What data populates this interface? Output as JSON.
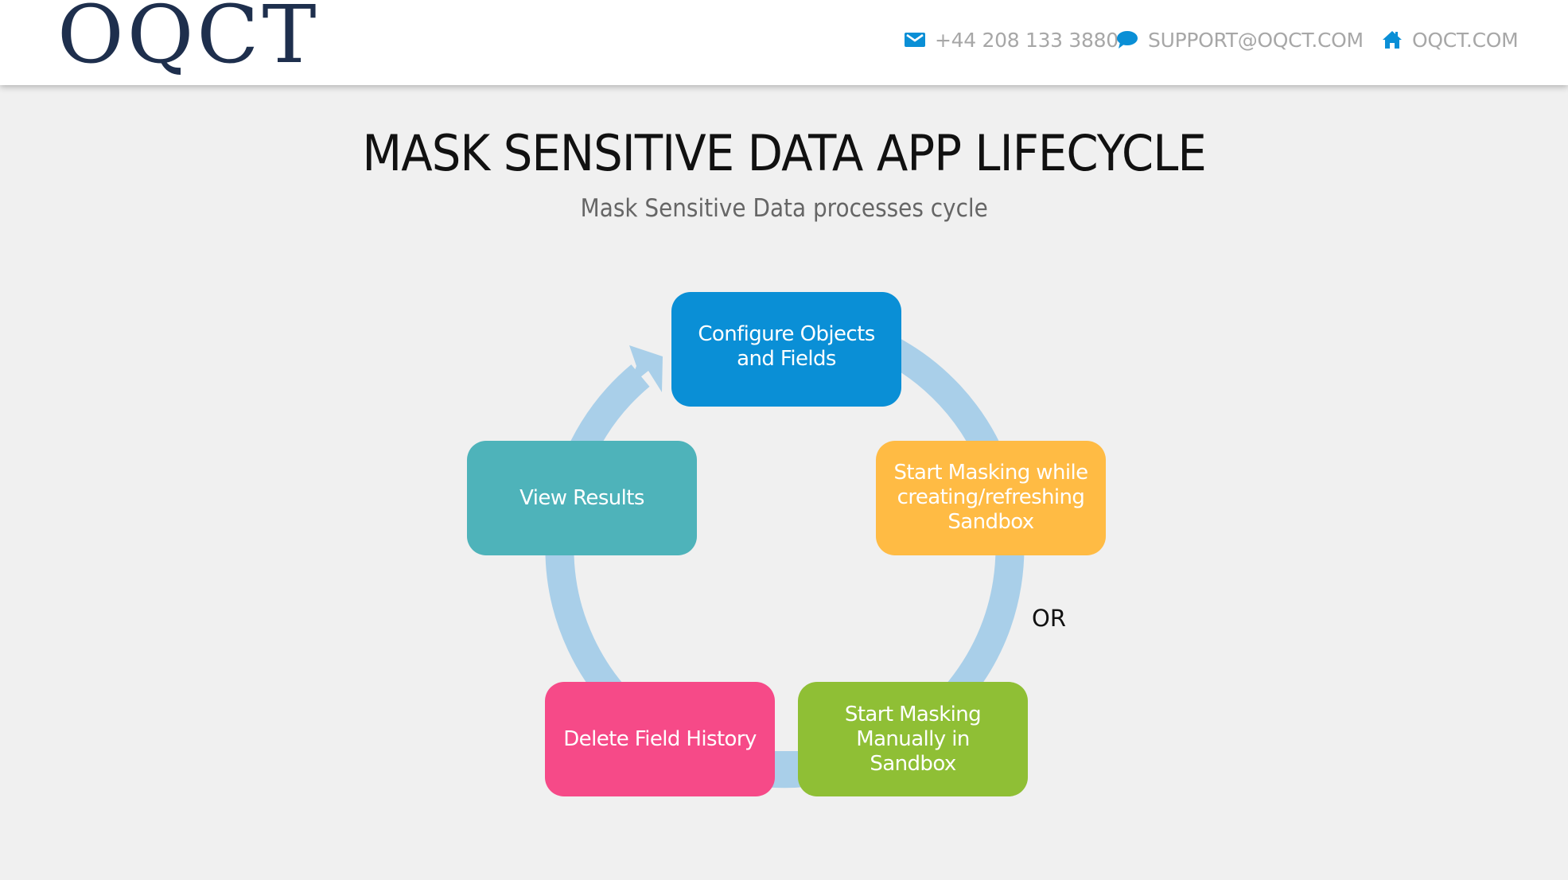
{
  "header": {
    "logo_text": "OQCT",
    "contacts": [
      {
        "icon": "envelope-icon",
        "text": "+44 208 133 3880"
      },
      {
        "icon": "chat-bubble-icon",
        "text": "SUPPORT@OQCT.COM"
      },
      {
        "icon": "home-icon",
        "text": "OQCT.COM"
      }
    ],
    "icon_color": "#0a8fd6",
    "text_color": "#a7a7a7"
  },
  "page": {
    "title": "MASK SENSITIVE DATA APP LIFECYCLE",
    "subtitle": "Mask Sensitive Data processes cycle"
  },
  "diagram": {
    "ring_color": "#a9cfe9",
    "steps": [
      {
        "label": "Configure Objects\nand Fields",
        "color": "#0a8fd6"
      },
      {
        "label": "Start Masking while\ncreating/refreshing\nSandbox",
        "color": "#ffbb44"
      },
      {
        "label": "Start Masking\nManually in\nSandbox",
        "color": "#8fbf35"
      },
      {
        "label": "Delete Field History",
        "color": "#f64a88"
      },
      {
        "label": "View Results",
        "color": "#4eb3ba"
      }
    ],
    "or_label": "OR"
  }
}
